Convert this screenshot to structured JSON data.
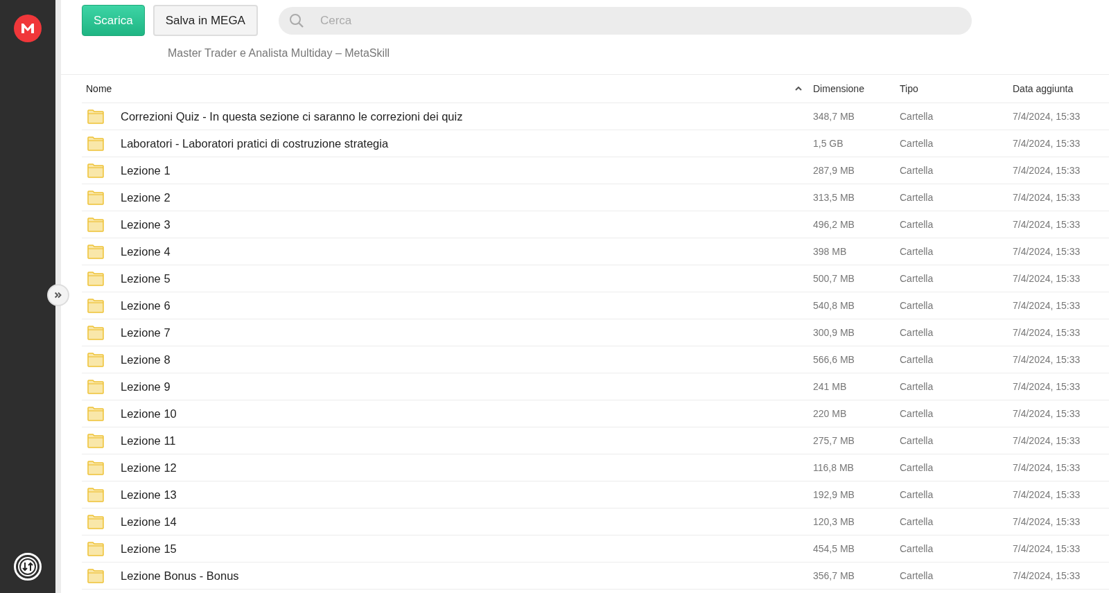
{
  "toolbar": {
    "download_button": "Scarica",
    "save_button": "Salva in MEGA",
    "search": {
      "placeholder": "Cerca"
    }
  },
  "folder_title": "Master Trader e Analista Multiday – MetaSkill",
  "table": {
    "columns": [
      {
        "label": "Nome",
        "sorted": true
      },
      {
        "label": "Dimensione",
        "sorted": false
      },
      {
        "label": "Tipo",
        "sorted": false
      },
      {
        "label": "Data aggiunta",
        "sorted": false
      }
    ],
    "rows": [
      {
        "name": "Correzioni Quiz - In questa sezione ci saranno le correzioni dei quiz",
        "size": "348,7 MB",
        "type": "Cartella",
        "date": "7/4/2024, 15:33"
      },
      {
        "name": "Laboratori - Laboratori pratici di costruzione strategia",
        "size": "1,5 GB",
        "type": "Cartella",
        "date": "7/4/2024, 15:33"
      },
      {
        "name": "Lezione 1",
        "size": "287,9 MB",
        "type": "Cartella",
        "date": "7/4/2024, 15:33"
      },
      {
        "name": "Lezione 2",
        "size": "313,5 MB",
        "type": "Cartella",
        "date": "7/4/2024, 15:33"
      },
      {
        "name": "Lezione 3",
        "size": "496,2 MB",
        "type": "Cartella",
        "date": "7/4/2024, 15:33"
      },
      {
        "name": "Lezione 4",
        "size": "398 MB",
        "type": "Cartella",
        "date": "7/4/2024, 15:33"
      },
      {
        "name": "Lezione 5",
        "size": "500,7 MB",
        "type": "Cartella",
        "date": "7/4/2024, 15:33"
      },
      {
        "name": "Lezione 6",
        "size": "540,8 MB",
        "type": "Cartella",
        "date": "7/4/2024, 15:33"
      },
      {
        "name": "Lezione 7",
        "size": "300,9 MB",
        "type": "Cartella",
        "date": "7/4/2024, 15:33"
      },
      {
        "name": "Lezione 8",
        "size": "566,6 MB",
        "type": "Cartella",
        "date": "7/4/2024, 15:33"
      },
      {
        "name": "Lezione 9",
        "size": "241 MB",
        "type": "Cartella",
        "date": "7/4/2024, 15:33"
      },
      {
        "name": "Lezione 10",
        "size": "220 MB",
        "type": "Cartella",
        "date": "7/4/2024, 15:33"
      },
      {
        "name": "Lezione 11",
        "size": "275,7 MB",
        "type": "Cartella",
        "date": "7/4/2024, 15:33"
      },
      {
        "name": "Lezione 12",
        "size": "116,8 MB",
        "type": "Cartella",
        "date": "7/4/2024, 15:33"
      },
      {
        "name": "Lezione 13",
        "size": "192,9 MB",
        "type": "Cartella",
        "date": "7/4/2024, 15:33"
      },
      {
        "name": "Lezione 14",
        "size": "120,3 MB",
        "type": "Cartella",
        "date": "7/4/2024, 15:33"
      },
      {
        "name": "Lezione 15",
        "size": "454,5 MB",
        "type": "Cartella",
        "date": "7/4/2024, 15:33"
      },
      {
        "name": "Lezione Bonus - Bonus",
        "size": "356,7 MB",
        "type": "Cartella",
        "date": "7/4/2024, 15:33"
      }
    ]
  }
}
